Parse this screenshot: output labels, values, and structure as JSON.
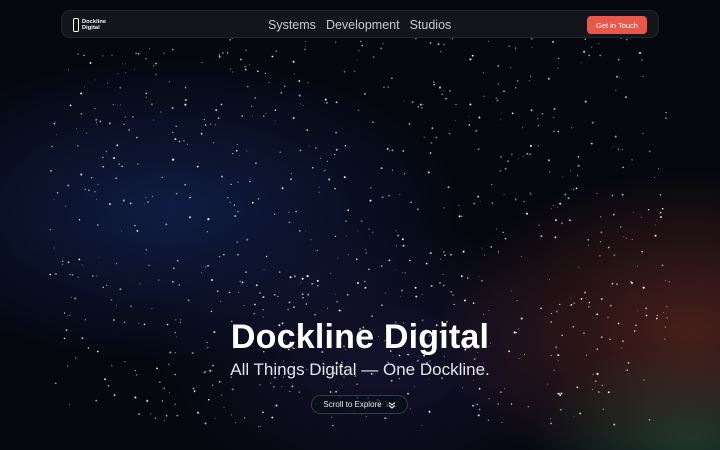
{
  "brand": {
    "line1": "Dockline",
    "line2": "Digital",
    "icon": "phone-outline-icon"
  },
  "nav": {
    "items": [
      {
        "label": "Systems"
      },
      {
        "label": "Development"
      },
      {
        "label": "Studios"
      }
    ],
    "cta_label": "Get in Touch"
  },
  "hero": {
    "title": "Dockline Digital",
    "subtitle": "All Things Digital — One Dockline.",
    "scroll_label": "Scroll to Explore",
    "scroll_icon": "double-chevron-down-icon"
  },
  "colors": {
    "accent": "#e8574a",
    "background": "#05070f",
    "nav_background": "#16181e"
  }
}
